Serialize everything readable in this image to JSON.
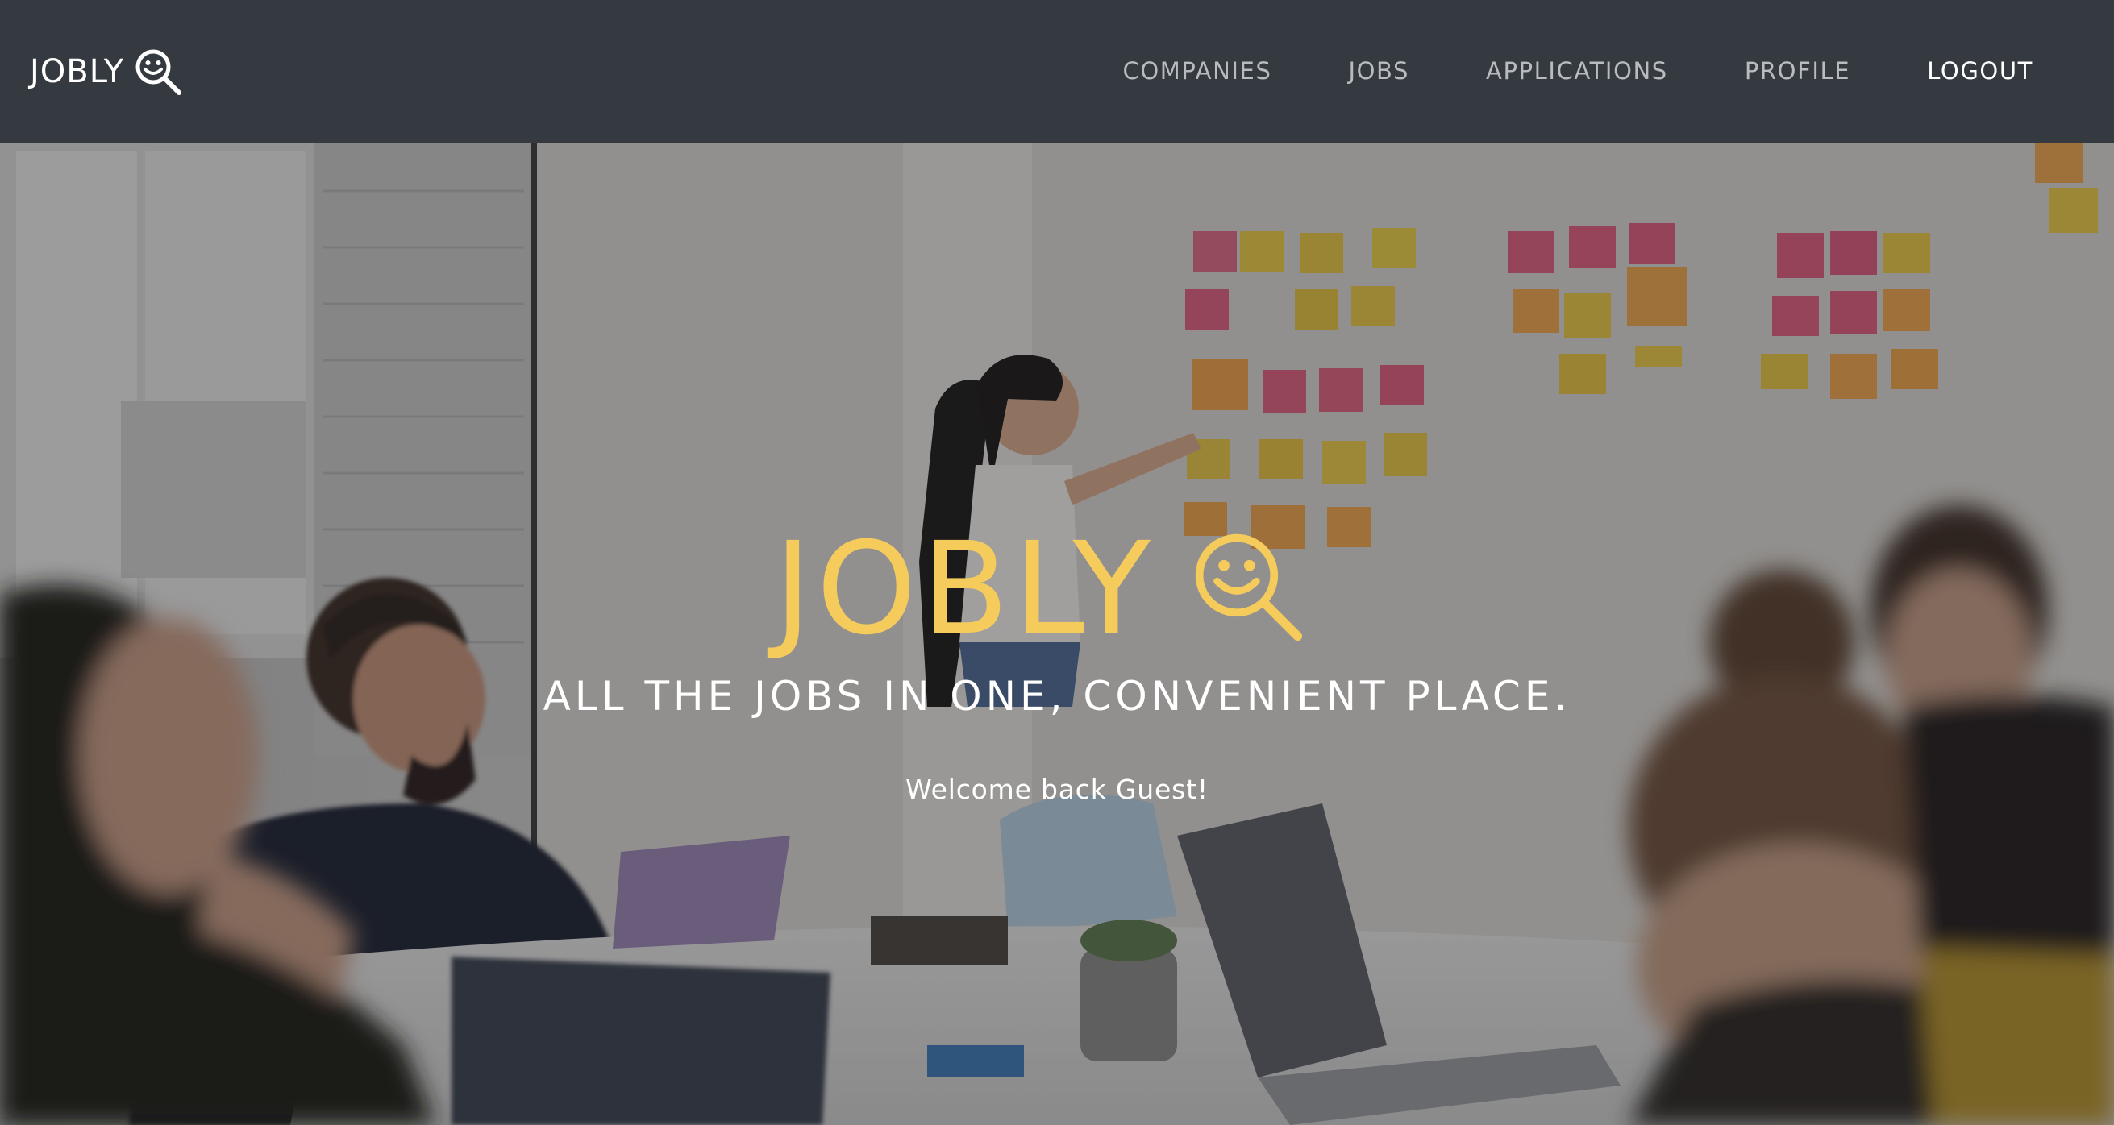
{
  "navbar": {
    "brand": "JOBLY",
    "brand_icon": "smiley-magnifier-icon",
    "links": [
      {
        "label": "COMPANIES"
      },
      {
        "label": "JOBS"
      },
      {
        "label": "APPLICATIONS"
      },
      {
        "label": "PROFILE"
      },
      {
        "label": "LOGOUT"
      }
    ]
  },
  "hero": {
    "logo_text": "JOBLY",
    "logo_icon": "smiley-magnifier-icon",
    "tagline": "ALL THE JOBS IN ONE, CONVENIENT PLACE.",
    "welcome": "Welcome back Guest!"
  },
  "colors": {
    "navbar_bg": "#343a40",
    "accent": "#f5cb5c",
    "nav_link": "#b8bcbf",
    "nav_link_active": "#ffffff"
  }
}
